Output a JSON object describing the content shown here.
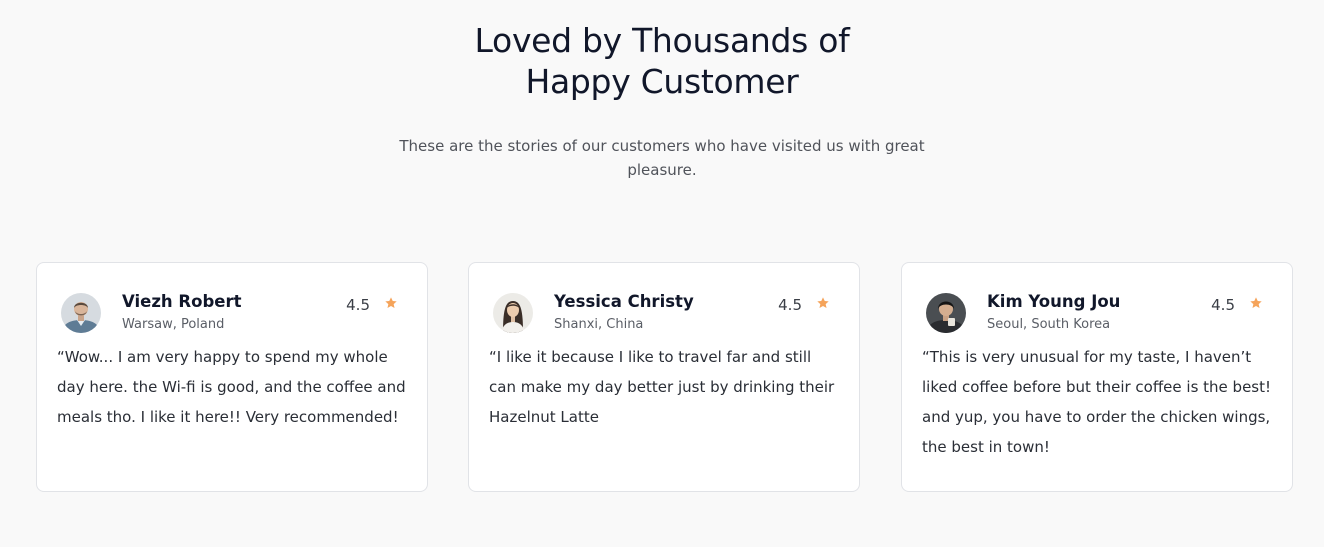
{
  "section": {
    "title_line1": "Loved by Thousands of",
    "title_line2": "Happy Customer",
    "subtitle": "These are the stories of our customers who have visited us with great pleasure."
  },
  "accent_color": "#f5a45b",
  "testimonials": [
    {
      "name": "Viezh Robert",
      "location": "Warsaw, Poland",
      "rating": "4.5",
      "quote": "“Wow... I am very happy to spend my whole day here. the Wi-fi is good, and the coffee and meals tho. I like it here!! Very recommended!"
    },
    {
      "name": "Yessica Christy",
      "location": "Shanxi, China",
      "rating": "4.5",
      "quote": "“I like it because I like to travel far and still can make my day better just by drinking their Hazelnut Latte"
    },
    {
      "name": "Kim Young Jou",
      "location": "Seoul, South Korea",
      "rating": "4.5",
      "quote": "“This is very unusual for my taste, I haven’t liked coffee before but their coffee is the best! and yup, you have to order the chicken wings, the best in town!"
    }
  ]
}
